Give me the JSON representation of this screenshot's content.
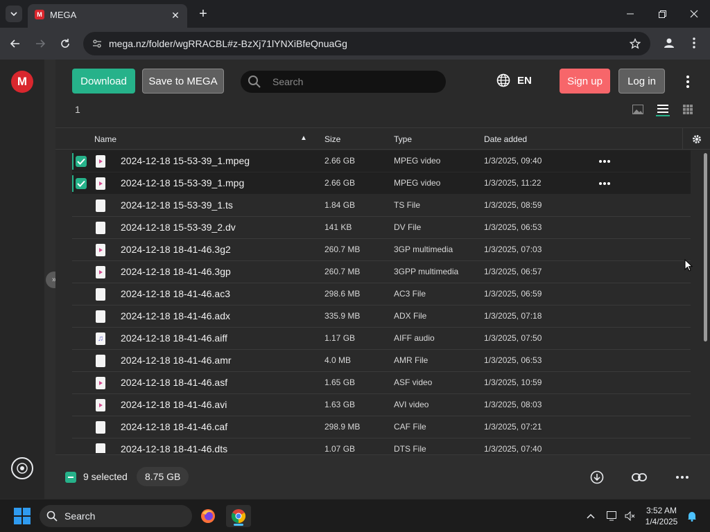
{
  "browser": {
    "tab_title": "MEGA",
    "favicon_letter": "M",
    "url": "mega.nz/folder/wgRRACBL#z-BzXj71lYNXiBfeQnuaGg"
  },
  "header": {
    "download_label": "Download",
    "save_label": "Save to MEGA",
    "search_placeholder": "Search",
    "language": "EN",
    "signup_label": "Sign up",
    "login_label": "Log in"
  },
  "breadcrumb": "1",
  "columns": {
    "name": "Name",
    "size": "Size",
    "type": "Type",
    "date": "Date added"
  },
  "files": [
    {
      "name": "2024-12-18 15-53-39_1.mpeg",
      "size": "2.66 GB",
      "type": "MPEG video",
      "date": "1/3/2025, 09:40"
    },
    {
      "name": "2024-12-18 15-53-39_1.mpg",
      "size": "2.66 GB",
      "type": "MPEG video",
      "date": "1/3/2025, 11:22"
    },
    {
      "name": "2024-12-18 15-53-39_1.ts",
      "size": "1.84 GB",
      "type": "TS File",
      "date": "1/3/2025, 08:59"
    },
    {
      "name": "2024-12-18 15-53-39_2.dv",
      "size": "141 KB",
      "type": "DV File",
      "date": "1/3/2025, 06:53"
    },
    {
      "name": "2024-12-18 18-41-46.3g2",
      "size": "260.7 MB",
      "type": "3GP multimedia",
      "date": "1/3/2025, 07:03"
    },
    {
      "name": "2024-12-18 18-41-46.3gp",
      "size": "260.7 MB",
      "type": "3GPP multimedia",
      "date": "1/3/2025, 06:57"
    },
    {
      "name": "2024-12-18 18-41-46.ac3",
      "size": "298.6 MB",
      "type": "AC3 File",
      "date": "1/3/2025, 06:59"
    },
    {
      "name": "2024-12-18 18-41-46.adx",
      "size": "335.9 MB",
      "type": "ADX File",
      "date": "1/3/2025, 07:18"
    },
    {
      "name": "2024-12-18 18-41-46.aiff",
      "size": "1.17 GB",
      "type": "AIFF audio",
      "date": "1/3/2025, 07:50"
    },
    {
      "name": "2024-12-18 18-41-46.amr",
      "size": "4.0 MB",
      "type": "AMR File",
      "date": "1/3/2025, 06:53"
    },
    {
      "name": "2024-12-18 18-41-46.asf",
      "size": "1.65 GB",
      "type": "ASF video",
      "date": "1/3/2025, 10:59"
    },
    {
      "name": "2024-12-18 18-41-46.avi",
      "size": "1.63 GB",
      "type": "AVI video",
      "date": "1/3/2025, 08:03"
    },
    {
      "name": "2024-12-18 18-41-46.caf",
      "size": "298.9 MB",
      "type": "CAF File",
      "date": "1/3/2025, 07:21"
    },
    {
      "name": "2024-12-18 18-41-46.dts",
      "size": "1.07 GB",
      "type": "DTS File",
      "date": "1/3/2025, 07:40"
    }
  ],
  "footer": {
    "selected_text": "9 selected",
    "selected_size": "8.75 GB"
  },
  "taskbar": {
    "search_label": "Search",
    "time": "3:52 AM",
    "date": "1/4/2025"
  },
  "colors": {
    "accent_green": "#26b28a",
    "signup_red": "#f7666a",
    "mega_red": "#d9272e"
  }
}
